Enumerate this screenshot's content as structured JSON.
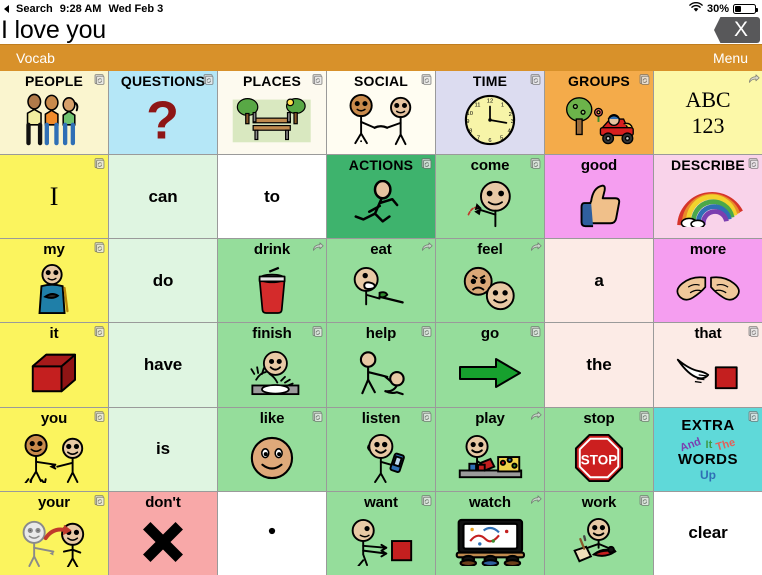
{
  "statusbar": {
    "back_label": "Search",
    "time": "9:28 AM",
    "date": "Wed Feb 3",
    "battery_percent": "30%",
    "wifi_icon": "wifi-icon",
    "battery_icon": "battery-icon"
  },
  "message_bar": {
    "text": "I love you",
    "clear_label": "X"
  },
  "toolbar": {
    "left_label": "Vocab",
    "right_label": "Menu",
    "background": "#d8912a"
  },
  "grid": {
    "columns": 7,
    "rows": 6,
    "cells": [
      {
        "label": "PEOPLE",
        "style": "cat",
        "bg": "#faf5cf",
        "art": "people-three-figures",
        "badge": "folder-link-icon"
      },
      {
        "label": "QUESTIONS",
        "style": "cat",
        "bg": "#b5e7f7",
        "art": "question-mark",
        "badge": "folder-link-icon"
      },
      {
        "label": "PLACES",
        "style": "cat",
        "bg": "#fdfaef",
        "art": "park-bench-trees",
        "badge": "folder-link-icon"
      },
      {
        "label": "SOCIAL",
        "style": "cat",
        "bg": "#fffdf2",
        "art": "two-people-handshake",
        "badge": "folder-link-icon"
      },
      {
        "label": "TIME",
        "style": "cat",
        "bg": "#dcdcf0",
        "art": "clock-face",
        "badge": "folder-link-icon"
      },
      {
        "label": "GROUPS",
        "style": "cat",
        "bg": "#f4ab4a",
        "art": "tree-and-car",
        "badge": "folder-link-icon"
      },
      {
        "label": "ABC\n123",
        "style": "serif",
        "bg": "#fcf8a8",
        "art": "",
        "badge": "jump-arrow-icon"
      },
      {
        "label": "I",
        "style": "serif-i",
        "bg": "#fbf45e",
        "art": "",
        "badge": "folder-link-icon"
      },
      {
        "label": "can",
        "style": "big",
        "bg": "#dff5e1",
        "art": "",
        "badge": ""
      },
      {
        "label": "to",
        "style": "big",
        "bg": "#ffffff",
        "art": "",
        "badge": ""
      },
      {
        "label": "ACTIONS",
        "style": "cat",
        "bg": "#3eb36d",
        "art": "running-figure",
        "badge": "folder-link-icon"
      },
      {
        "label": "come",
        "style": "",
        "bg": "#95dd9b",
        "art": "come-beckon",
        "badge": "folder-link-icon"
      },
      {
        "label": "good",
        "style": "",
        "bg": "#f59ef0",
        "art": "thumbs-up",
        "badge": ""
      },
      {
        "label": "DESCRIBE",
        "style": "cat",
        "bg": "#f9d3ea",
        "art": "rainbow-cloud",
        "badge": "folder-link-icon"
      },
      {
        "label": "my",
        "style": "",
        "bg": "#fbf45e",
        "art": "person-hand-chest",
        "badge": "folder-link-icon"
      },
      {
        "label": "do",
        "style": "big",
        "bg": "#dff5e1",
        "art": "",
        "badge": ""
      },
      {
        "label": "drink",
        "style": "",
        "bg": "#95dd9b",
        "art": "drink-cup-straw",
        "badge": "jump-arrow-icon"
      },
      {
        "label": "eat",
        "style": "",
        "bg": "#95dd9b",
        "art": "eat-fork-person",
        "badge": "jump-arrow-icon"
      },
      {
        "label": "feel",
        "style": "",
        "bg": "#95dd9b",
        "art": "two-faces-emotion",
        "badge": "jump-arrow-icon"
      },
      {
        "label": "a",
        "style": "big",
        "bg": "#fcebe6",
        "art": "",
        "badge": ""
      },
      {
        "label": "more",
        "style": "",
        "bg": "#f59ef0",
        "art": "two-hands-more",
        "badge": ""
      },
      {
        "label": "it",
        "style": "",
        "bg": "#fbf45e",
        "art": "red-cube",
        "badge": "folder-link-icon"
      },
      {
        "label": "have",
        "style": "big",
        "bg": "#dff5e1",
        "art": "",
        "badge": ""
      },
      {
        "label": "finish",
        "style": "",
        "bg": "#95dd9b",
        "art": "finish-empty-plate",
        "badge": "folder-link-icon"
      },
      {
        "label": "help",
        "style": "",
        "bg": "#95dd9b",
        "art": "help-lifting",
        "badge": "folder-link-icon"
      },
      {
        "label": "go",
        "style": "",
        "bg": "#95dd9b",
        "art": "green-arrow",
        "badge": "folder-link-icon"
      },
      {
        "label": "the",
        "style": "big",
        "bg": "#fcebe6",
        "art": "",
        "badge": ""
      },
      {
        "label": "that",
        "style": "",
        "bg": "#fcebe6",
        "art": "pointing-hand-square",
        "badge": "folder-link-icon"
      },
      {
        "label": "you",
        "style": "",
        "bg": "#fbf45e",
        "art": "two-people-pointing",
        "badge": "folder-link-icon"
      },
      {
        "label": "is",
        "style": "big",
        "bg": "#dff5e1",
        "art": "",
        "badge": ""
      },
      {
        "label": "like",
        "style": "",
        "bg": "#95dd9b",
        "art": "smiling-face",
        "badge": "folder-link-icon"
      },
      {
        "label": "listen",
        "style": "",
        "bg": "#95dd9b",
        "art": "listen-phone-ear",
        "badge": "folder-link-icon"
      },
      {
        "label": "play",
        "style": "",
        "bg": "#95dd9b",
        "art": "play-toys",
        "badge": "jump-arrow-icon"
      },
      {
        "label": "stop",
        "style": "",
        "bg": "#95dd9b",
        "art": "stop-sign",
        "badge": "folder-link-icon"
      },
      {
        "label": "EXTRA",
        "style": "extra",
        "bg": "#5fd9d9",
        "art": "extra-words-art",
        "badge": "folder-link-icon"
      },
      {
        "label": "your",
        "style": "",
        "bg": "#fbf45e",
        "art": "your-pointing-pair",
        "badge": "folder-link-icon"
      },
      {
        "label": "don't",
        "style": "",
        "bg": "#f8a8a8",
        "art": "black-x-mark",
        "badge": ""
      },
      {
        "label": ".",
        "style": "dot",
        "bg": "#ffffff",
        "art": "period-dot",
        "badge": ""
      },
      {
        "label": "want",
        "style": "",
        "bg": "#95dd9b",
        "art": "want-reach-square",
        "badge": "folder-link-icon"
      },
      {
        "label": "watch",
        "style": "",
        "bg": "#95dd9b",
        "art": "watch-tv-screen",
        "badge": "jump-arrow-icon"
      },
      {
        "label": "work",
        "style": "",
        "bg": "#95dd9b",
        "art": "work-desk-book",
        "badge": "folder-link-icon"
      },
      {
        "label": "clear",
        "style": "big",
        "bg": "#ffffff",
        "art": "",
        "badge": ""
      }
    ]
  },
  "extra_words": {
    "top": "EXTRA",
    "bottom": "WORDS",
    "small": [
      {
        "text": "And",
        "color": "#7b3fb0"
      },
      {
        "text": "It",
        "color": "#3d9c4a"
      },
      {
        "text": "The",
        "color": "#e2605a"
      },
      {
        "text": "Up",
        "color": "#2f6fb5"
      }
    ]
  }
}
